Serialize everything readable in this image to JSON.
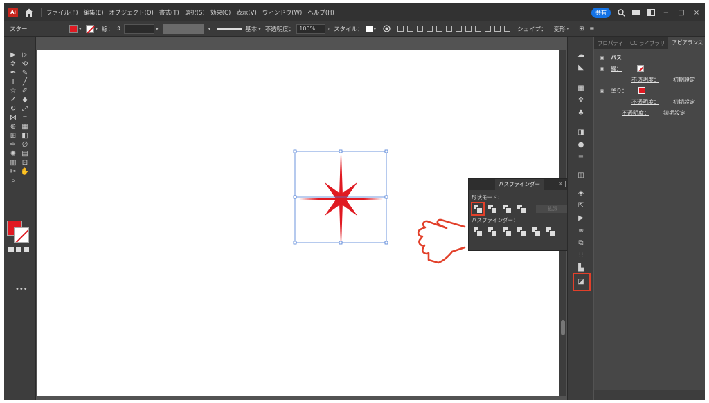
{
  "menubar": {
    "app_icon_text": "Ai",
    "items": [
      "ファイル(F)",
      "編集(E)",
      "オブジェクト(O)",
      "書式(T)",
      "選択(S)",
      "効果(C)",
      "表示(V)",
      "ウィンドウ(W)",
      "ヘルプ(H)"
    ],
    "share_label": "共有"
  },
  "controlbar": {
    "object_type": "スター",
    "stroke_label": "線：",
    "stroke_style_label": "基本",
    "opacity_label": "不透明度：",
    "opacity_value": "100%",
    "style_label": "スタイル：",
    "shape_label": "シェイプ：",
    "transform_label": "変形"
  },
  "pathfinder": {
    "tab_inactive": "",
    "tab_active": "パスファインダー",
    "shape_modes_label": "形状モード：",
    "expand_label": "拡張",
    "pathfinders_label": "パスファインダー："
  },
  "appearance": {
    "tabs": [
      "プロパティ",
      "CC ライブラリ",
      "アピアランス"
    ],
    "object_label": "パス",
    "stroke_label": "線：",
    "stroke_opacity_label": "不透明度：",
    "stroke_opacity_value": "初期設定",
    "fill_label": "塗り：",
    "fill_opacity_label": "不透明度：",
    "fill_opacity_value": "初期設定",
    "object_opacity_label": "不透明度：",
    "object_opacity_value": "初期設定"
  },
  "colors": {
    "fill": "#e01a22",
    "highlight": "#e2402a",
    "selection": "#4a7bd6"
  }
}
